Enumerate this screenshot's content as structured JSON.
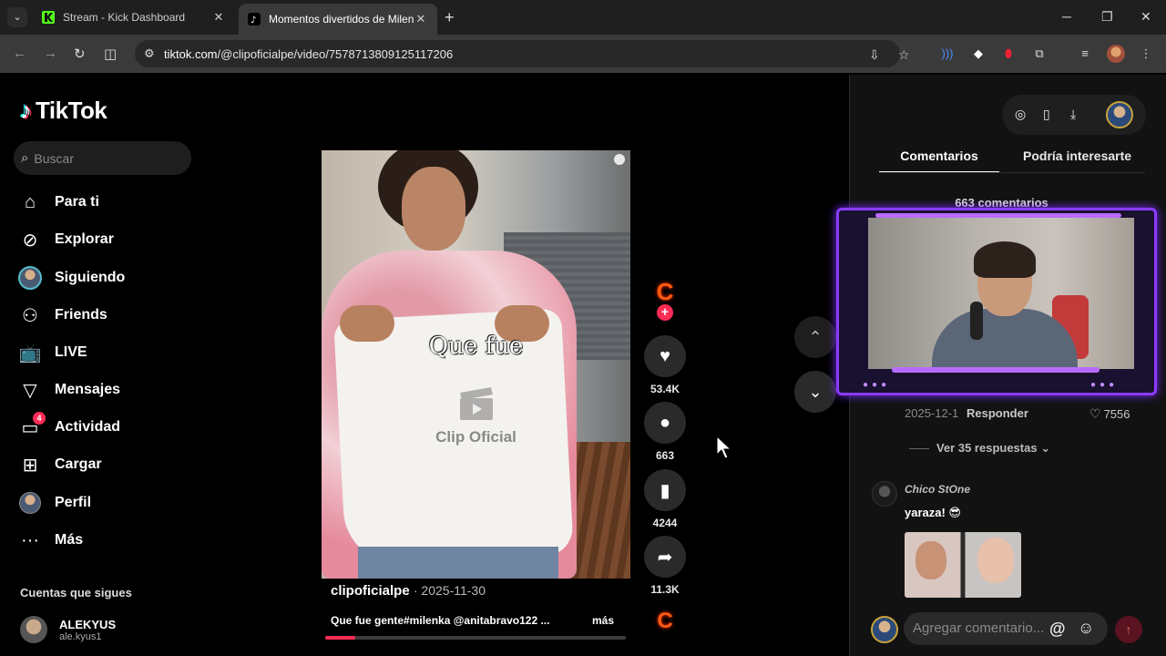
{
  "browser": {
    "tabs": [
      {
        "title": "Stream - Kick Dashboard"
      },
      {
        "title": "Momentos divertidos de Milenka"
      }
    ],
    "url_prefix": "tiktok.com",
    "url_path": "/@clipoficialpe/video/7578713809125117206"
  },
  "tiktok": {
    "logo": "TikTok",
    "search_placeholder": "Buscar",
    "nav": [
      {
        "label": "Para ti",
        "icon": "home-icon"
      },
      {
        "label": "Explorar",
        "icon": "compass-icon"
      },
      {
        "label": "Siguiendo",
        "icon": "following-avatar-icon"
      },
      {
        "label": "Friends",
        "icon": "friends-icon"
      },
      {
        "label": "LIVE",
        "icon": "live-tv-icon"
      },
      {
        "label": "Mensajes",
        "icon": "send-message-icon"
      },
      {
        "label": "Actividad",
        "icon": "activity-icon",
        "badge": "4"
      },
      {
        "label": "Cargar",
        "icon": "upload-plus-icon"
      },
      {
        "label": "Perfil",
        "icon": "profile-avatar-icon"
      },
      {
        "label": "Más",
        "icon": "more-dots-icon"
      }
    ],
    "following_section_title": "Cuentas que sigues",
    "followed_account": {
      "name": "ALEKYUS",
      "handle": "ale.kyus1"
    }
  },
  "video": {
    "overlay_caption": "Que fue",
    "watermark": "Clip Oficial",
    "author": "clipoficialpe",
    "date": "· 2025-11-30",
    "description": "Que fue gente#milenka @anitabravo122 ...",
    "more_label": "más",
    "progress_fraction": 0.1,
    "stats": {
      "likes": "53.4K",
      "comments": "663",
      "saves": "4244",
      "shares": "11.3K"
    },
    "creator_badge": "C"
  },
  "comments_panel": {
    "tabs": [
      "Comentarios",
      "Podría interesarte"
    ],
    "count_label": "663 comentarios",
    "comment1": {
      "date": "2025-12-1",
      "reply_label": "Responder",
      "likes": "7556"
    },
    "view_replies": "Ver 35 respuestas",
    "comment2": {
      "author": "Chico StOne",
      "text": "yaraza! 😎"
    },
    "input_placeholder": "Agregar comentario...",
    "at_symbol": "@"
  },
  "colors": {
    "accent": "#fe2c55",
    "stream_frame": "#8a3cff"
  }
}
